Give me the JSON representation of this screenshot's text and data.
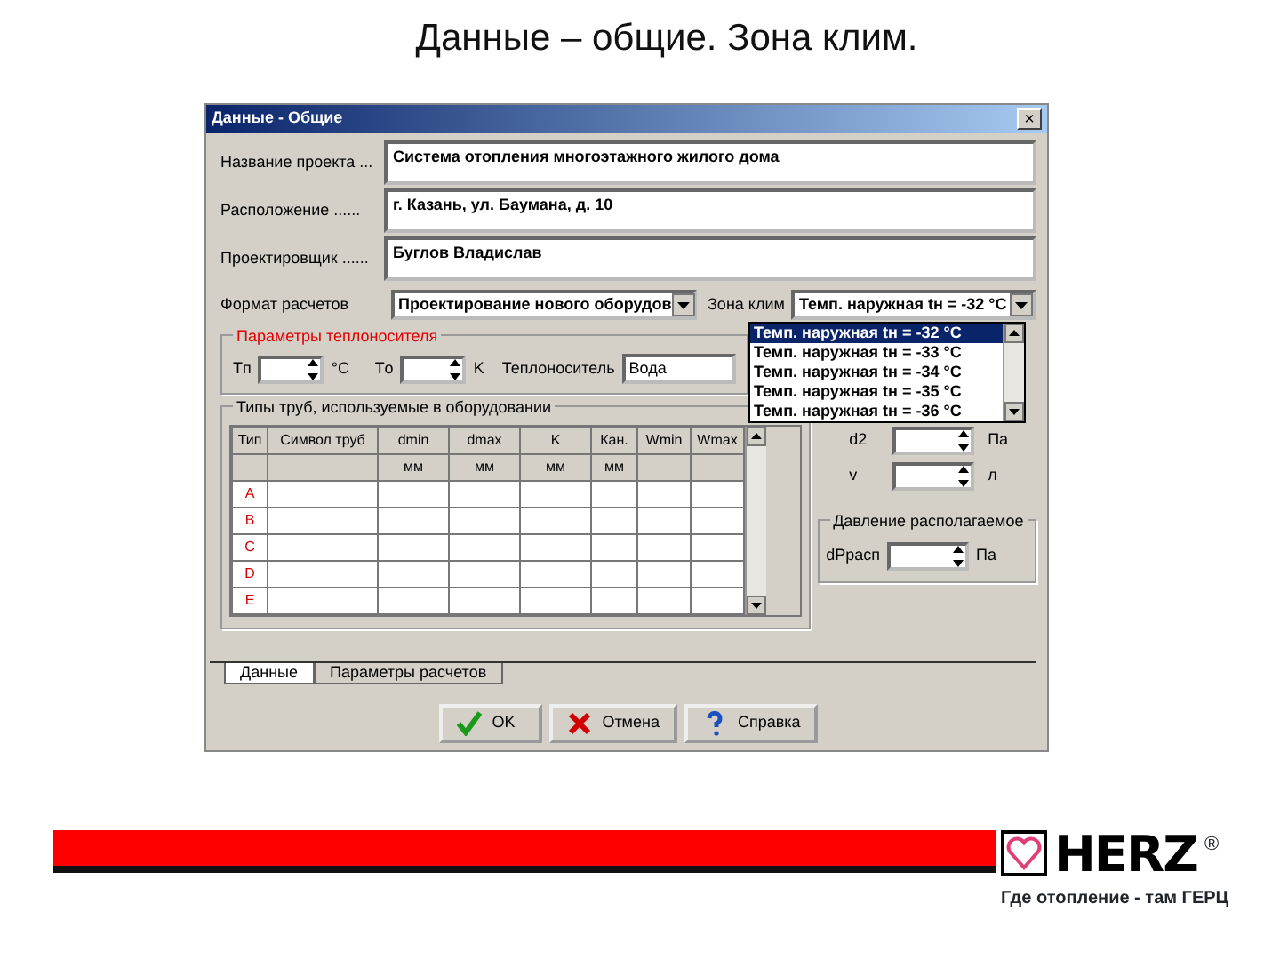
{
  "slide_title": "Данные – общие. Зона клим.",
  "window": {
    "title": "Данные - Общие",
    "close": "×"
  },
  "fields": [
    {
      "label": "Название проекта ...",
      "value": "Система отопления многоэтажного жилого дома"
    },
    {
      "label": "Расположение ......",
      "value": "г. Казань, ул. Баумана, д. 10"
    },
    {
      "label": "Проектировщик ......",
      "value": "Буглов Владислав"
    }
  ],
  "format": {
    "label": "Формат расчетов",
    "value": "Проектирование нового оборудов"
  },
  "climate": {
    "label": "Зона клим",
    "value": "Темп. наружная tн = -32 °C",
    "options": [
      {
        "text": "Темп. наружная tн = -32 °C",
        "selected": true
      },
      {
        "text": "Темп. наружная tн = -33 °C",
        "selected": false
      },
      {
        "text": "Темп. наружная tн = -34 °C",
        "selected": false
      },
      {
        "text": "Темп. наружная tн = -35 °C",
        "selected": false
      },
      {
        "text": "Темп. наружная tн = -36 °C",
        "selected": false
      }
    ]
  },
  "coolant": {
    "title": "Параметры теплоносителя",
    "tp_label": "Tп",
    "tp_unit": "°C",
    "to_label": "Tо",
    "to_unit": "K",
    "medium_label": "Теплоноситель",
    "medium": "Вода"
  },
  "pipes": {
    "title": "Типы труб, используемые в оборудовании",
    "columns": [
      {
        "name": "Тип"
      },
      {
        "name": "Символ труб"
      },
      {
        "name": "dmin",
        "unit": "мм"
      },
      {
        "name": "dmax",
        "unit": "мм"
      },
      {
        "name": "K",
        "unit": "мм"
      },
      {
        "name": "Кан.",
        "unit": "мм"
      },
      {
        "name": "Wmin"
      },
      {
        "name": "Wmax"
      }
    ],
    "rows": [
      "A",
      "B",
      "C",
      "D",
      "E"
    ]
  },
  "right": {
    "rows": [
      {
        "label": "d2",
        "unit": "Па"
      },
      {
        "label": "v",
        "unit": "л"
      }
    ],
    "pressure": {
      "title": "Давление располагаемое",
      "label": "dPрасп",
      "unit": "Па"
    }
  },
  "tabs": [
    {
      "label": "Данные",
      "selected": true
    },
    {
      "label": "Параметры расчетов",
      "selected": false
    }
  ],
  "buttons": [
    {
      "label": "OK",
      "kind": "ok"
    },
    {
      "label": "Отмена",
      "kind": "cancel"
    },
    {
      "label": "Справка",
      "kind": "help"
    }
  ],
  "footer": {
    "brand": "HERZ",
    "registered": "®",
    "tagline": "Где отопление - там ГЕРЦ"
  }
}
